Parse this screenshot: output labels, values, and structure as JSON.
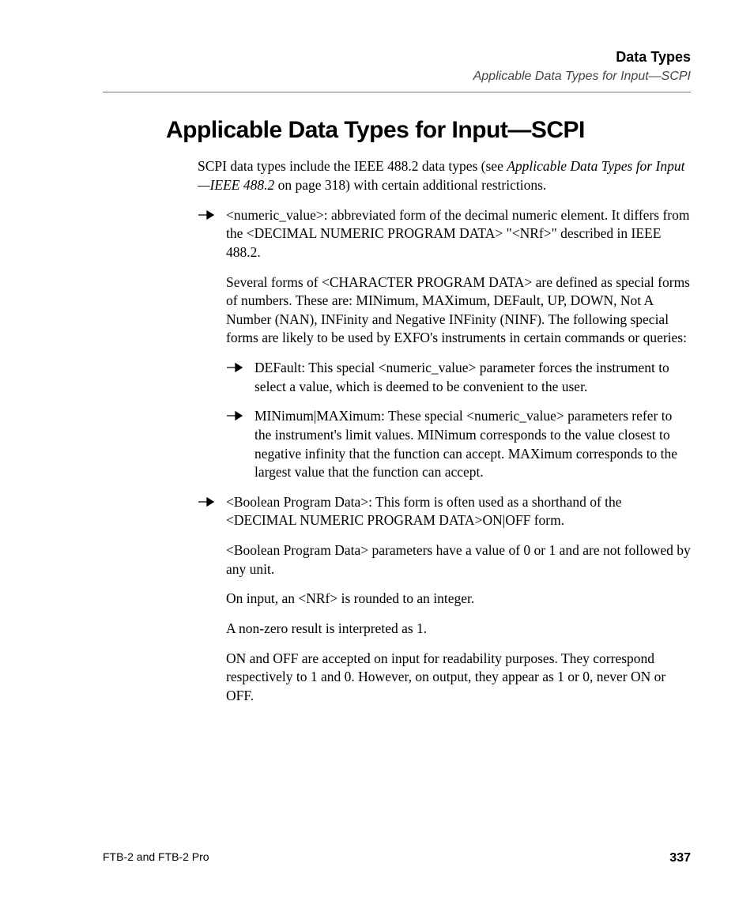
{
  "header": {
    "chapter": "Data Types",
    "section": "Applicable Data Types for Input—SCPI"
  },
  "title": "Applicable Data Types for Input—SCPI",
  "intro_pre": "SCPI data types include the IEEE 488.2 data types (see ",
  "intro_ital": "Applicable Data Types for Input—IEEE 488.2",
  "intro_post": " on page 318) with certain additional restrictions.",
  "b1": {
    "p1": "<numeric_value>: abbreviated form of the decimal numeric element. It differs from the <DECIMAL NUMERIC PROGRAM DATA> \"<NRf>\" described in IEEE 488.2.",
    "p2": "Several forms of <CHARACTER PROGRAM DATA> are defined as special forms of numbers. These are: MINimum, MAXimum, DEFault, UP, DOWN, Not A Number (NAN), INFinity and Negative INFinity (NINF). The following special forms are likely to be used by EXFO's instruments in certain commands or queries:",
    "sub1": "DEFault: This special <numeric_value> parameter forces the instrument to select a value, which is deemed to be convenient to the user.",
    "sub2": "MINimum|MAXimum: These special <numeric_value> parameters refer to the instrument's limit values. MINimum corresponds to the value closest to negative infinity that the function can accept. MAXimum corresponds to the largest value that the function can accept."
  },
  "b2": {
    "p1": "<Boolean Program Data>: This form is often used as a shorthand of the <DECIMAL NUMERIC PROGRAM DATA>ON|OFF form.",
    "p2": "<Boolean Program Data> parameters have a value of 0 or 1 and are not followed by any unit.",
    "p3": "On input, an <NRf> is rounded to an integer.",
    "p4": "A non-zero result is interpreted as 1.",
    "p5": "ON and OFF are accepted on input for readability purposes. They correspond respectively to 1 and 0. However, on output, they appear as 1 or 0, never ON or OFF."
  },
  "footer": {
    "left": "FTB-2 and FTB-2 Pro",
    "page": "337"
  }
}
